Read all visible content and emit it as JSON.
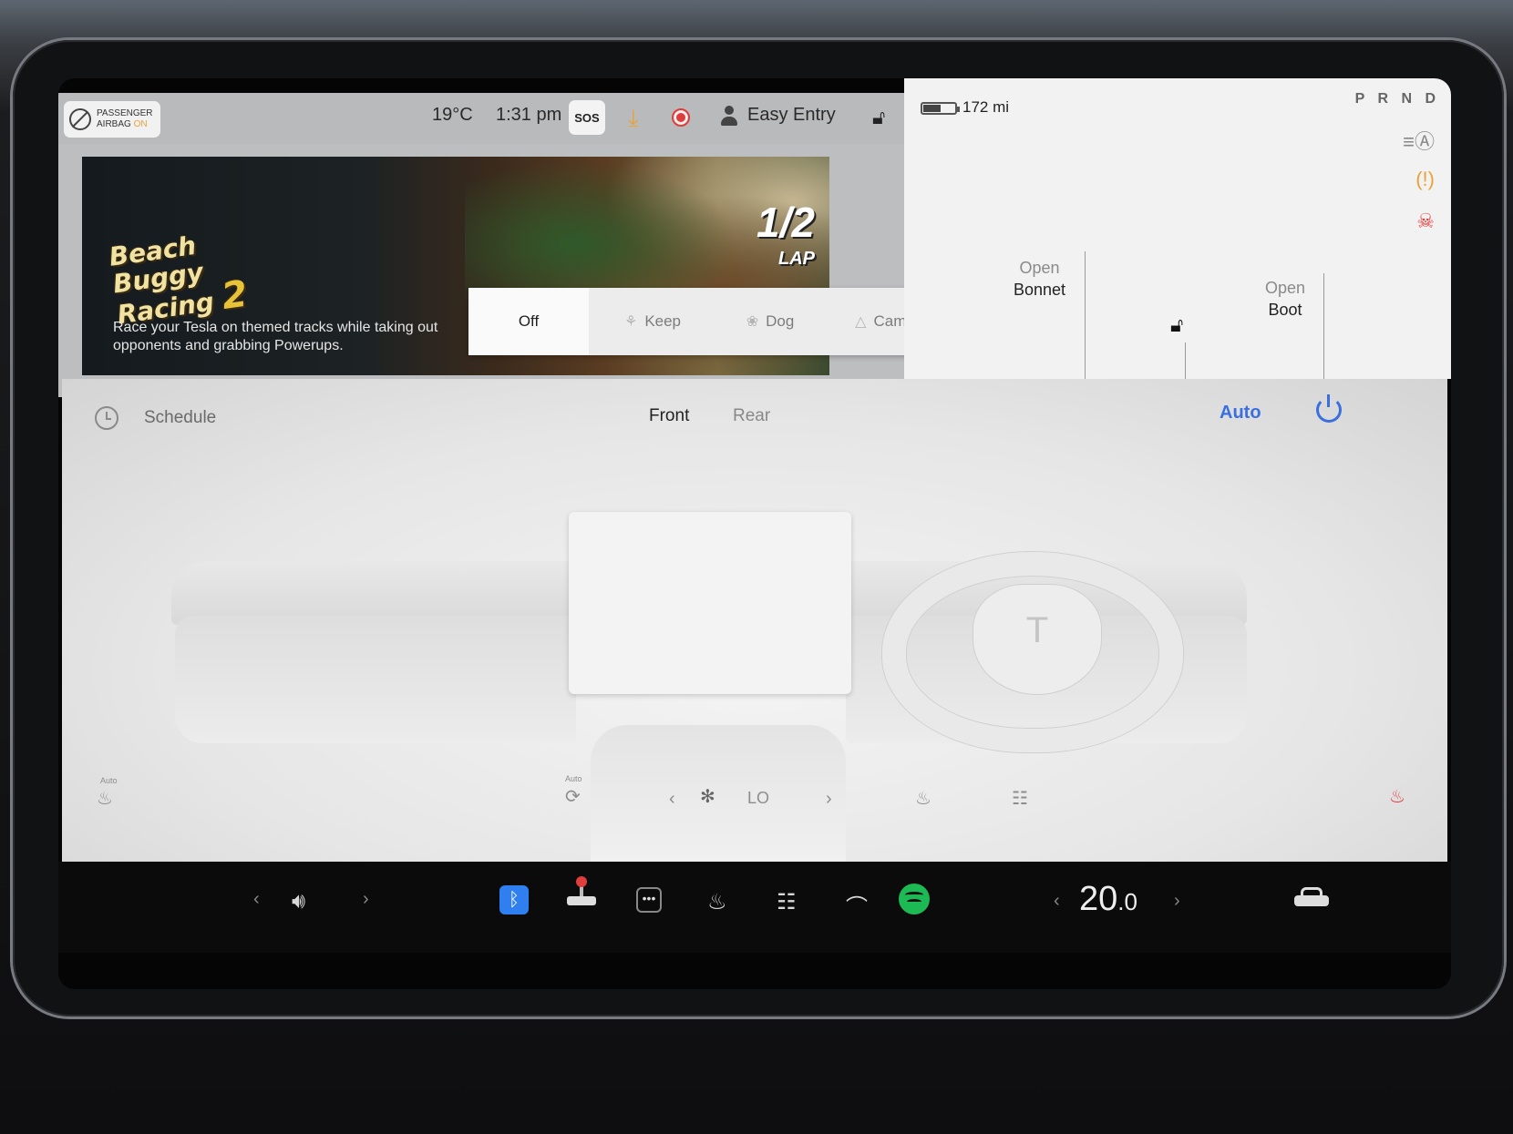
{
  "status_bar": {
    "airbag_line1": "PASSENGER",
    "airbag_line2": "AIRBAG",
    "airbag_state": "ON",
    "temperature": "19°C",
    "time": "1:31 pm",
    "sos": "SOS",
    "profile": "Easy Entry"
  },
  "media": {
    "game_title_line1": "Beach Buggy",
    "game_title_line2": "Racing",
    "game_title_num": "2",
    "lap_value": "1/2",
    "lap_label": "LAP",
    "description": "Race your Tesla on themed tracks while taking out opponents and grabbing Powerups."
  },
  "climate_modes": [
    {
      "label": "Off",
      "icon": "",
      "active": true
    },
    {
      "label": "Keep",
      "icon": "fan-icon",
      "active": false
    },
    {
      "label": "Dog",
      "icon": "paw-icon",
      "active": false
    },
    {
      "label": "Camp",
      "icon": "tent-icon",
      "active": false
    }
  ],
  "car_panel": {
    "range": "172 mi",
    "battery_level": 0.55,
    "gear": "P R N D",
    "bonnet_line1": "Open",
    "bonnet_line2": "Bonnet",
    "boot_line1": "Open",
    "boot_line2": "Boot"
  },
  "climate": {
    "schedule_label": "Schedule",
    "tab_front": "Front",
    "tab_rear": "Rear",
    "auto_label": "Auto",
    "seat_left_auto": "Auto",
    "recirc_auto": "Auto",
    "fan_value": "LO"
  },
  "dock": {
    "temperature_whole": "20",
    "temperature_decimal": ".0"
  },
  "colors": {
    "accent_blue": "#3a6fe0",
    "warning_orange": "#e8a33a",
    "alert_red": "#e03d3d",
    "spotify_green": "#1db954"
  }
}
